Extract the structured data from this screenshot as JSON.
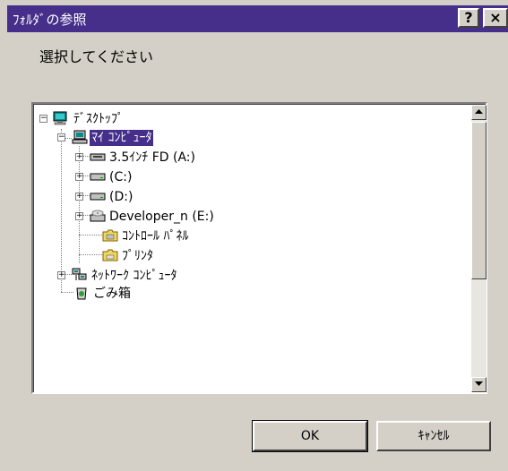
{
  "window": {
    "title": "ﾌｫﾙﾀﾞの参照",
    "help_label": "?",
    "close_label": "×"
  },
  "prompt": "選択してください",
  "tree": {
    "items": [
      {
        "label": "ﾃﾞｽｸﾄｯﾌﾟ",
        "icon": "desktop-icon",
        "expander": "−"
      },
      {
        "label": "ﾏｲ ｺﾝﾋﾟｭｰﾀ",
        "icon": "my-computer-icon",
        "expander": "−",
        "selected": true
      },
      {
        "label": "3.5ｲﾝﾁ FD (A:)",
        "icon": "floppy-drive-icon",
        "expander": "+"
      },
      {
        "label": "(C:)",
        "icon": "hard-drive-icon",
        "expander": "+"
      },
      {
        "label": "(D:)",
        "icon": "hard-drive-icon",
        "expander": "+"
      },
      {
        "label": "Developer_n (E:)",
        "icon": "cd-drive-icon",
        "expander": "+"
      },
      {
        "label": "ｺﾝﾄﾛｰﾙ ﾊﾟﾈﾙ",
        "icon": "control-panel-folder-icon",
        "expander": ""
      },
      {
        "label": "ﾌﾟﾘﾝﾀ",
        "icon": "printers-folder-icon",
        "expander": ""
      },
      {
        "label": "ﾈｯﾄﾜｰｸ ｺﾝﾋﾟｭｰﾀ",
        "icon": "network-icon",
        "expander": "+"
      },
      {
        "label": "ごみ箱",
        "icon": "recycle-bin-icon",
        "expander": ""
      }
    ]
  },
  "buttons": {
    "ok": "OK",
    "cancel": "ｷｬﾝｾﾙ"
  },
  "colors": {
    "titlebar": "#452f8a",
    "selection": "#452f8a",
    "face": "#d4d0c8"
  }
}
